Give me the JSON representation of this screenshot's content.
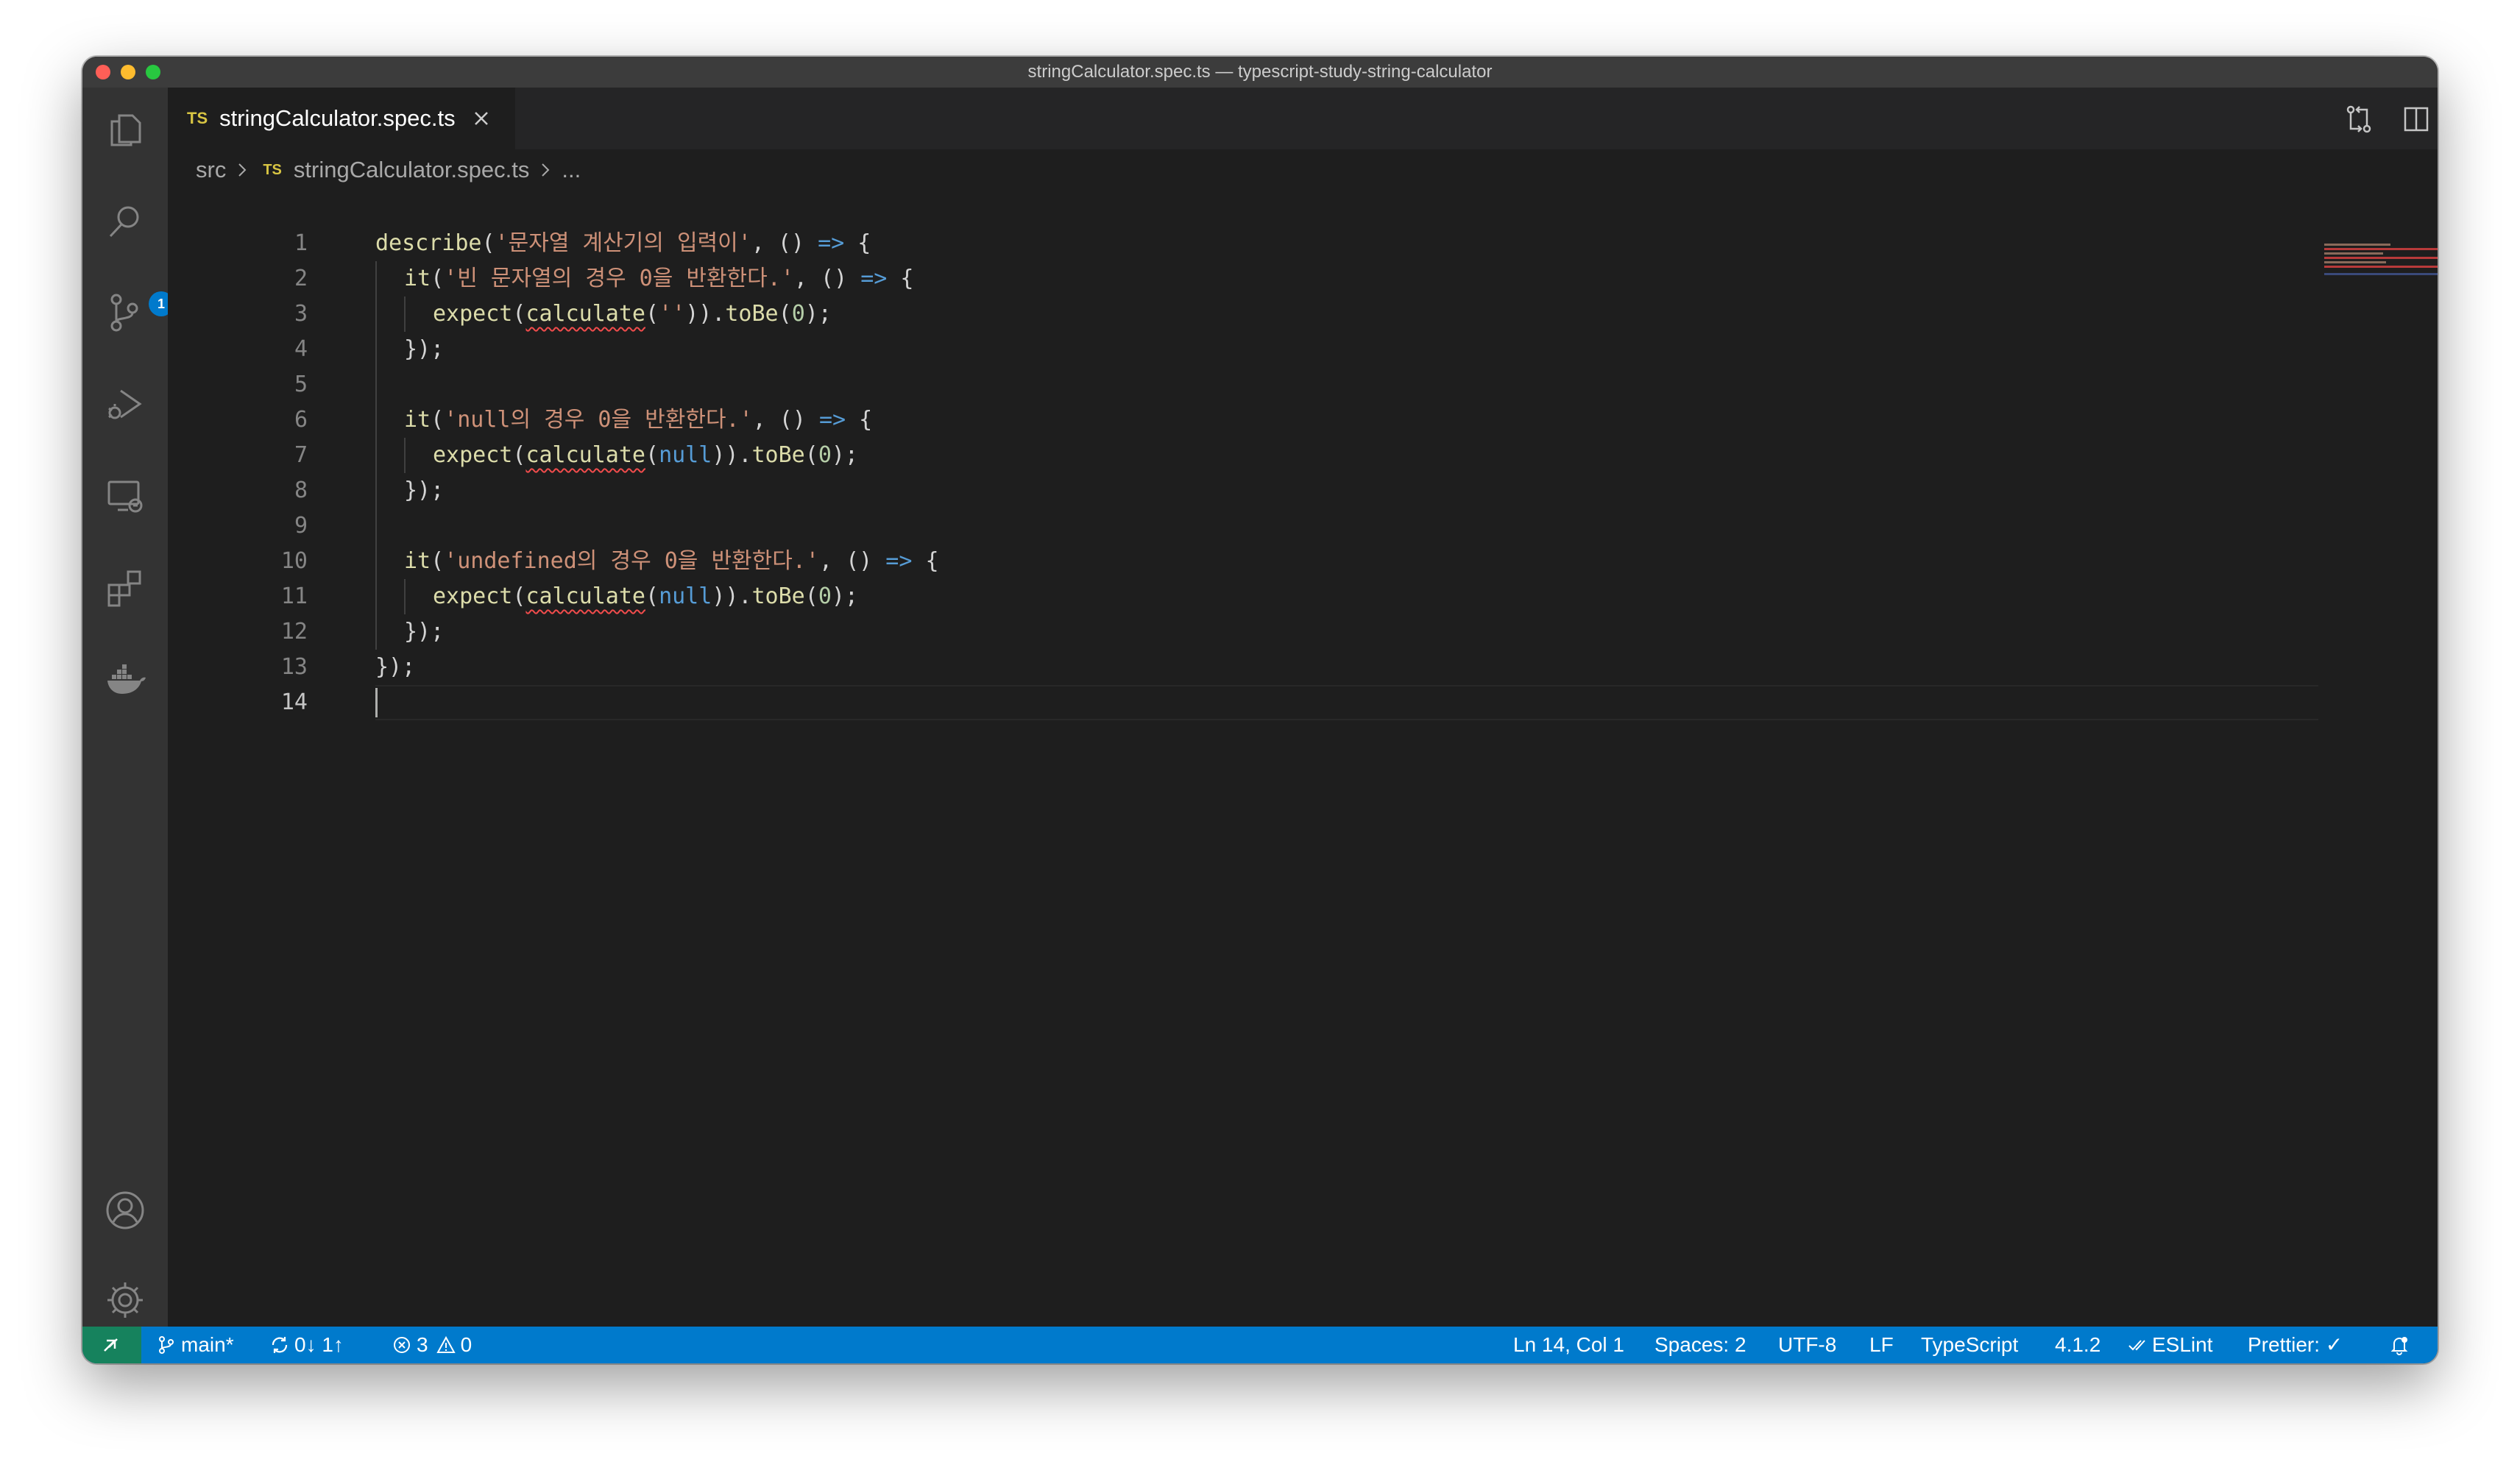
{
  "window": {
    "title": "stringCalculator.spec.ts — typescript-study-string-calculator"
  },
  "activity_bar": {
    "items": [
      "explorer-icon",
      "search-icon",
      "source-control-icon",
      "run-debug-icon",
      "remote-explorer-icon",
      "extensions-icon",
      "docker-icon"
    ],
    "source_control_badge": "1",
    "bottom_items": [
      "account-icon",
      "settings-gear-icon"
    ]
  },
  "tab": {
    "lang_badge": "TS",
    "label": "stringCalculator.spec.ts"
  },
  "breadcrumb": {
    "folder": "src",
    "lang_badge": "TS",
    "file": "stringCalculator.spec.ts",
    "more": "..."
  },
  "editor": {
    "line_numbers": [
      "1",
      "2",
      "3",
      "4",
      "5",
      "6",
      "7",
      "8",
      "9",
      "10",
      "11",
      "12",
      "13",
      "14"
    ],
    "lines": [
      "describe('문자열 계산기의 입력이', () => {",
      "  it('빈 문자열의 경우 0을 반환한다.', () => {",
      "    expect(calculate('')).toBe(0);",
      "  });",
      "",
      "  it('null의 경우 0을 반환한다.', () => {",
      "    expect(calculate(null)).toBe(0);",
      "  });",
      "",
      "  it('undefined의 경우 0을 반환한다.', () => {",
      "    expect(calculate(null)).toBe(0);",
      "  });",
      "});",
      ""
    ],
    "tokens": {
      "describe": "describe",
      "it": "it",
      "expect": "expect",
      "calculate": "calculate",
      "toBe": "toBe",
      "null_kw": "null",
      "arrow": "=>",
      "zero": "0",
      "str1": "'문자열 계산기의 입력이'",
      "str2": "'빈 문자열의 경우 0을 반환한다.'",
      "str_empty": "''",
      "str3": "'null의 경우 0을 반환한다.'",
      "str4": "'undefined의 경우 0을 반환한다.'"
    }
  },
  "status_bar": {
    "branch": "main*",
    "sync": "0↓ 1↑",
    "errors": "3",
    "warnings": "0",
    "position": "Ln 14, Col 1",
    "spaces": "Spaces: 2",
    "encoding": "UTF-8",
    "eol": "LF",
    "language": "TypeScript",
    "ts_version": "4.1.2",
    "eslint": "ESLint",
    "prettier": "Prettier: ✓"
  },
  "colors": {
    "status_bar": "#007acc",
    "remote_indicator": "#16825d",
    "editor_bg": "#1e1e1e",
    "error": "#f14c4c"
  }
}
